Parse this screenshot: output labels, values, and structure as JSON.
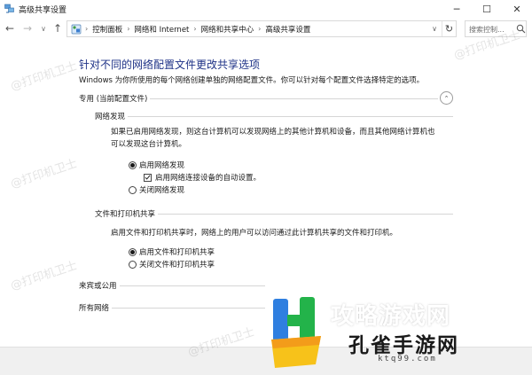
{
  "window": {
    "title": "高级共享设置",
    "controls": {
      "minimize": "─",
      "maximize": "☐",
      "close": "✕"
    }
  },
  "navigation": {
    "back": "←",
    "forward": "→",
    "history": "∨",
    "up": "↑",
    "breadcrumbs": [
      "控制面板",
      "网络和 Internet",
      "网络和共享中心",
      "高级共享设置"
    ],
    "separator": "›",
    "dropdown": "∨",
    "refresh": "↻",
    "search_placeholder": "搜索控制..."
  },
  "content": {
    "heading": "针对不同的网络配置文件更改共享选项",
    "intro": "Windows 为你所使用的每个网络创建单独的网络配置文件。你可以针对每个配置文件选择特定的选项。",
    "private_profile": {
      "label": "专用 (当前配置文件)",
      "collapse_glyph": "⌃",
      "network_discovery": {
        "label": "网络发现",
        "description_line1": "如果已启用网络发现，则这台计算机可以发现网络上的其他计算机和设备，而且其他网络计算机也",
        "description_line2": "可以发现这台计算机。",
        "turn_on": "启用网络发现",
        "auto_setup": "启用网络连接设备的自动设置。",
        "turn_off": "关闭网络发现",
        "selected": "on",
        "auto_setup_checked": true
      },
      "file_printer_sharing": {
        "label": "文件和打印机共享",
        "description": "启用文件和打印机共享时，网络上的用户可以访问通过此计算机共享的文件和打印机。",
        "turn_on": "启用文件和打印机共享",
        "turn_off": "关闭文件和打印机共享",
        "selected": "on"
      }
    },
    "guest_public": {
      "label": "来宾或公用"
    },
    "all_networks": {
      "label": "所有网络"
    }
  },
  "watermark": {
    "text": "@打印机卫士"
  },
  "brand_overlay": {
    "title": "孔雀手游网",
    "top_text": "攻略游戏网",
    "url": "ktq99.com"
  },
  "colors": {
    "heading": "#1e3287",
    "footer_bg": "#f0f0f0",
    "logo_blue": "#2f7fe0",
    "logo_green": "#23b34a",
    "logo_yellow": "#f7c21a"
  }
}
